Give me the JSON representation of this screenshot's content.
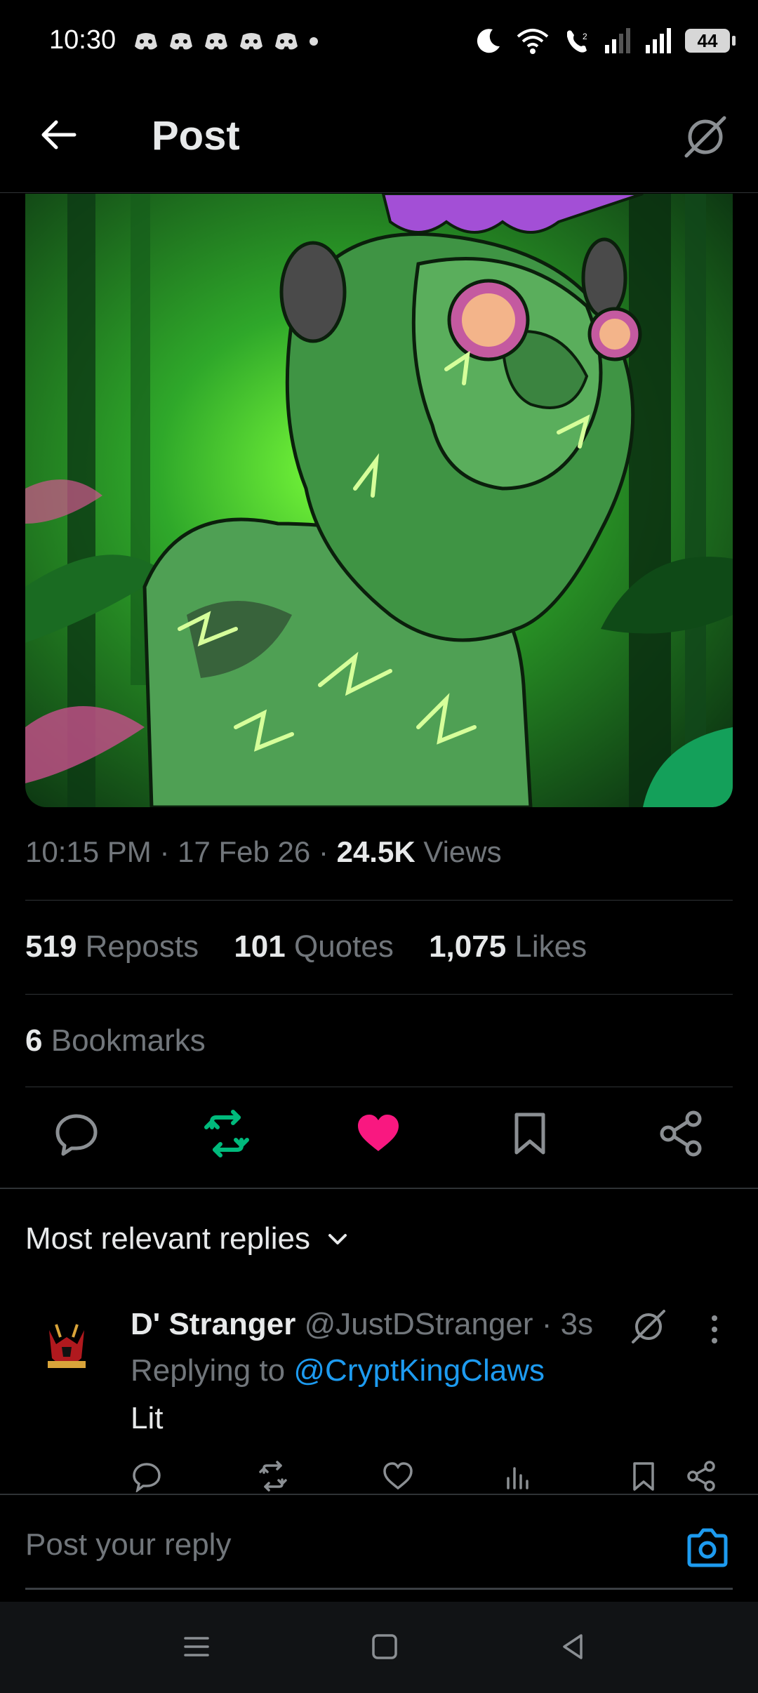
{
  "status_bar": {
    "time": "10:30",
    "battery": "44"
  },
  "header": {
    "title": "Post"
  },
  "post": {
    "time": "10:15 PM",
    "date": "17 Feb 26",
    "views_count": "24.5K",
    "views_label": "Views",
    "reposts_count": "519",
    "reposts_label": "Reposts",
    "quotes_count": "101",
    "quotes_label": "Quotes",
    "likes_count": "1,075",
    "likes_label": "Likes",
    "bookmarks_count": "6",
    "bookmarks_label": "Bookmarks",
    "liked": true,
    "reposted": true,
    "accent_like": "#f91880",
    "accent_repost": "#00ba7c"
  },
  "replies": {
    "header": "Most relevant replies",
    "items": [
      {
        "name": "D' Stranger",
        "handle": "@JustDStranger",
        "time": "3s",
        "replying_prefix": "Replying to",
        "replying_to": "@CryptKingClaws",
        "text": "Lit"
      }
    ]
  },
  "composer": {
    "placeholder": "Post your reply",
    "accent": "#1d9bf0"
  }
}
